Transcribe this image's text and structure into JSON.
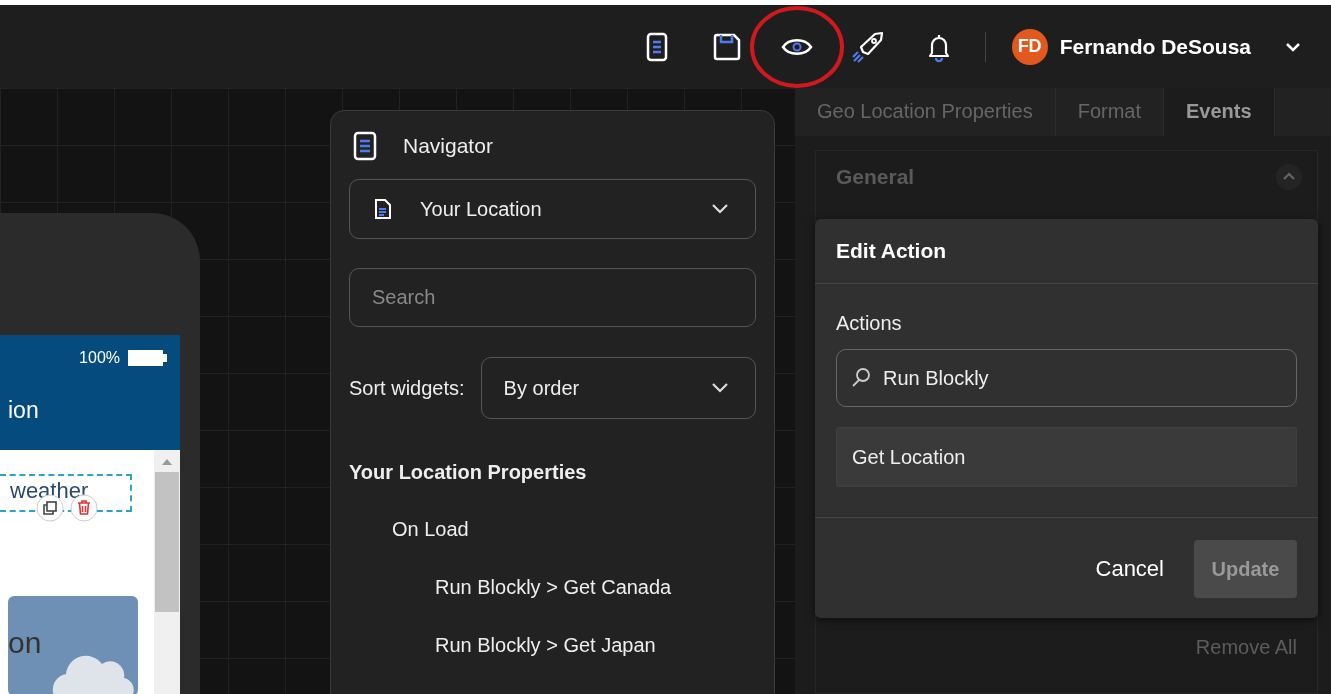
{
  "topbar": {
    "tools": [
      {
        "kind": "document",
        "highlighted": false
      },
      {
        "kind": "save",
        "highlighted": false
      },
      {
        "kind": "preview",
        "highlighted": true
      },
      {
        "kind": "rocket",
        "highlighted": false
      },
      {
        "kind": "bell",
        "highlighted": false
      }
    ],
    "user": {
      "initials": "FD",
      "name": "Fernando DeSousa"
    }
  },
  "phone": {
    "battery": "100%",
    "title_fragment": "ion",
    "widget_text": "weather",
    "card_text": "on"
  },
  "navigator": {
    "title": "Navigator",
    "page_select": "Your Location",
    "search": {
      "placeholder": "Search"
    },
    "sort_label": "Sort widgets:",
    "sort_select": "By order",
    "tree": {
      "label": "Your Location Properties",
      "children": [
        {
          "label": "On Load",
          "children": [
            {
              "label": "Run Blockly > Get Canada"
            },
            {
              "label": "Run Blockly > Get Japan"
            }
          ]
        }
      ]
    }
  },
  "properties": {
    "tabs": [
      {
        "label": "Geo Location Properties",
        "selected": false
      },
      {
        "label": "Format",
        "selected": false
      },
      {
        "label": "Events",
        "selected": true
      }
    ],
    "section": {
      "title": "General",
      "expanded": true
    },
    "remove_all": "Remove All"
  },
  "dialog": {
    "title": "Edit Action",
    "field_label": "Actions",
    "search_value": "Run Blockly",
    "options": [
      "Get Location"
    ],
    "cancel": "Cancel",
    "update": {
      "label": "Update",
      "disabled": true
    }
  }
}
